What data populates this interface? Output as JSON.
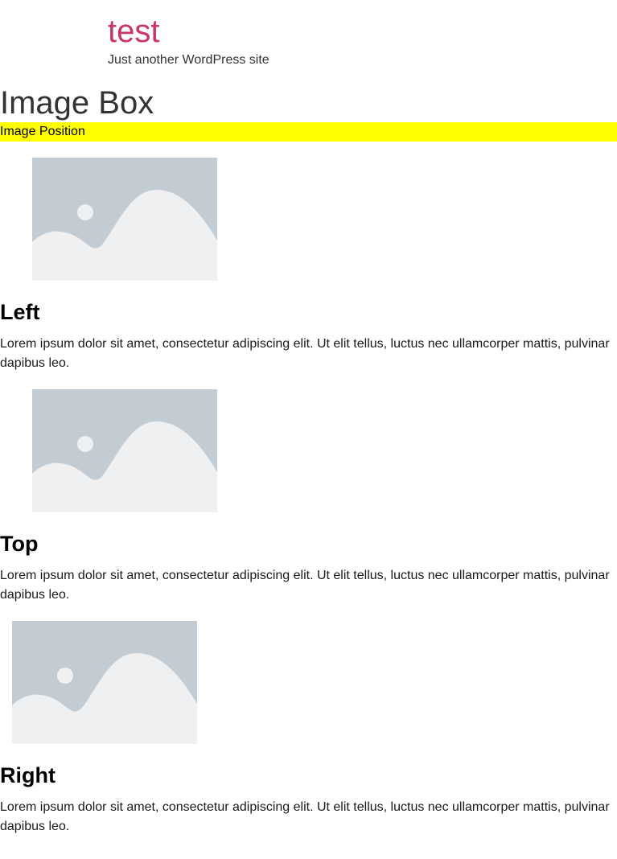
{
  "site": {
    "title": "test",
    "tagline": "Just another WordPress site"
  },
  "page": {
    "title": "Image Box"
  },
  "section": {
    "label": "Image Position",
    "highlight_color": "#ffff00"
  },
  "boxes": [
    {
      "image_icon": "image-placeholder-icon",
      "title": "Left",
      "text": "Lorem ipsum dolor sit amet, consectetur adipiscing elit. Ut elit tellus, luctus nec ullamcorper mattis, pulvinar dapibus leo."
    },
    {
      "image_icon": "image-placeholder-icon",
      "title": "Top",
      "text": "Lorem ipsum dolor sit amet, consectetur adipiscing elit. Ut elit tellus, luctus nec ullamcorper mattis, pulvinar dapibus leo."
    },
    {
      "image_icon": "image-placeholder-icon",
      "title": "Right",
      "text": "Lorem ipsum dolor sit amet, consectetur adipiscing elit. Ut elit tellus, luctus nec ullamcorper mattis, pulvinar dapibus leo."
    }
  ],
  "colors": {
    "site_title": "#c8356a",
    "placeholder_bg": "#c3cbd3",
    "placeholder_fg": "#eff0f1"
  }
}
